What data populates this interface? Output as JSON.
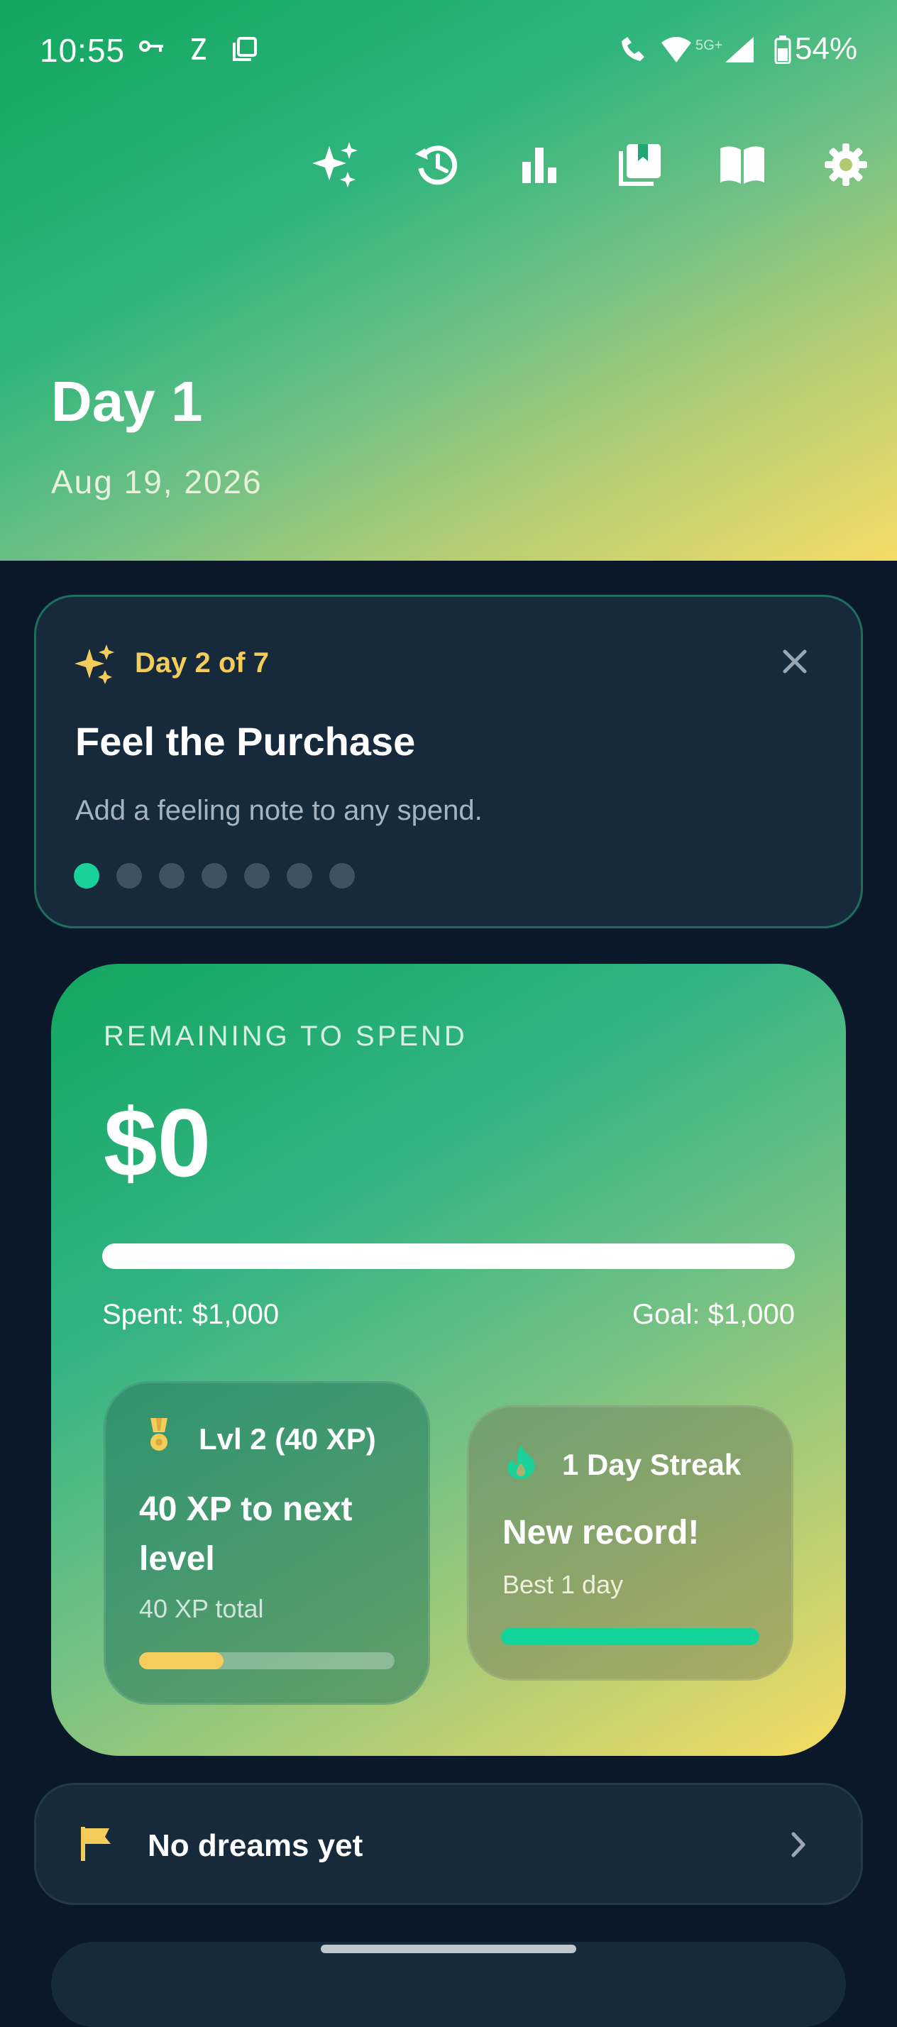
{
  "status_bar": {
    "time": "10:55",
    "network_label": "5G+",
    "battery": "54%"
  },
  "toolbar": {
    "icons": [
      "sparkles-icon",
      "history-icon",
      "bar-chart-icon",
      "library-icon",
      "book-icon",
      "gear-icon"
    ]
  },
  "header": {
    "day_title": "Day 1",
    "date": "Aug 19, 2026"
  },
  "tip_card": {
    "step": "Day 2 of 7",
    "title": "Feel the Purchase",
    "description": "Add a feeling note to any spend.",
    "total_steps": 7,
    "current_step": 1
  },
  "budget": {
    "label": "REMAINING TO SPEND",
    "amount": "$0",
    "spent_text": "Spent: $1,000",
    "goal_text": "Goal: $1,000",
    "spent_fraction": 1.0
  },
  "level_card": {
    "heading": "Lvl 2 (40 XP)",
    "main": "40 XP to next level",
    "total": "40 XP total",
    "progress_fraction": 0.33
  },
  "streak_card": {
    "heading": "1 Day Streak",
    "main": "New record!",
    "best": "Best 1 day",
    "progress_fraction": 1.0
  },
  "dreams": {
    "label": "No dreams yet"
  },
  "colors": {
    "accent_green": "#18d29a",
    "accent_yellow": "#f4cc5c",
    "background": "#0b1829",
    "card": "#172a3b"
  }
}
